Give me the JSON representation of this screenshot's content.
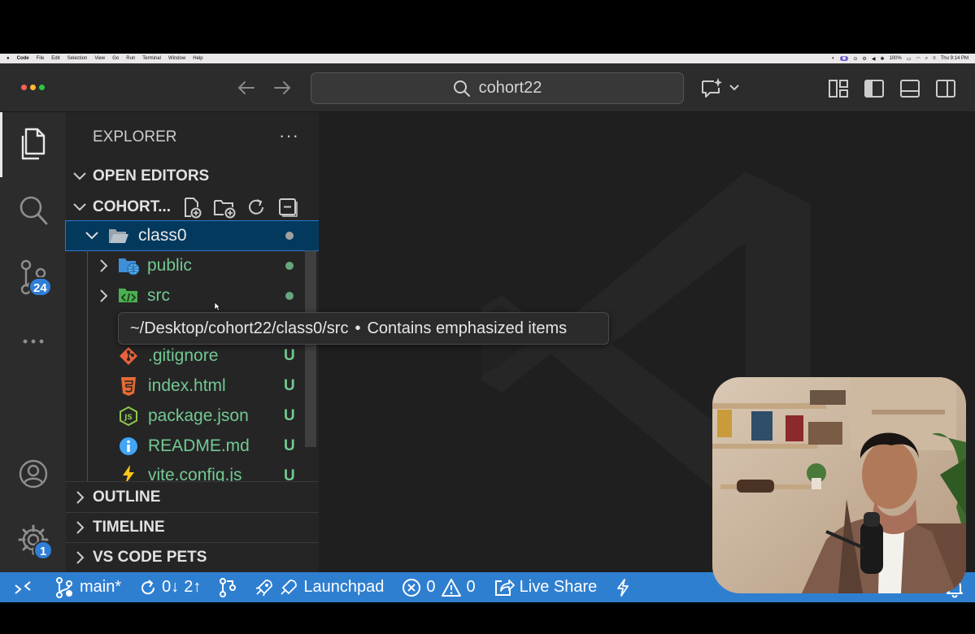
{
  "menubar": {
    "apple": "",
    "items": [
      "Code",
      "File",
      "Edit",
      "Selection",
      "View",
      "Go",
      "Run",
      "Terminal",
      "Window",
      "Help"
    ],
    "battery": "100%",
    "clock": "Thu 9:14 PM"
  },
  "titlebar": {
    "search_text": "cohort22"
  },
  "activity": {
    "scm_badge": "24",
    "settings_badge": "1"
  },
  "explorer": {
    "title": "EXPLORER",
    "more": "···",
    "open_editors": "OPEN EDITORS",
    "workspace": "COHORT...",
    "tree": {
      "class0": "class0",
      "public": "public",
      "src": "src",
      "gitignore": ".gitignore",
      "index_html": "index.html",
      "package_json": "package.json",
      "readme": "README.md",
      "vite_config": "vite.config.js",
      "untracked_mark": "U"
    },
    "outline": "OUTLINE",
    "timeline": "TIMELINE",
    "pets": "VS CODE PETS"
  },
  "tooltip": {
    "path": "~/Desktop/cohort22/class0/src",
    "separator": "•",
    "message": "Contains emphasized items"
  },
  "statusbar": {
    "branch": "main*",
    "sync_in": "0↓",
    "sync_out": "2↑",
    "launchpad": "Launchpad",
    "errors": "0",
    "warnings": "0",
    "live_share": "Live Share"
  },
  "colors": {
    "accent": "#2f7fd0",
    "untracked_green": "#73c991",
    "selection": "#04395e",
    "badge_blue": "#2f7ed8"
  }
}
